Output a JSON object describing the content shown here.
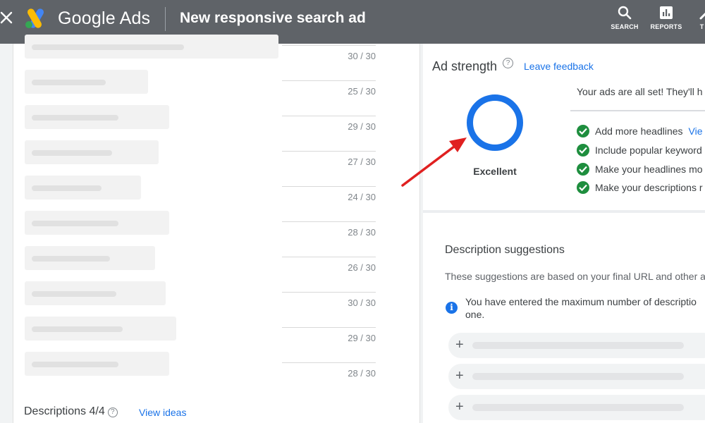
{
  "topbar": {
    "brand": "Google Ads",
    "page_title": "New responsive search ad",
    "tools": [
      {
        "label": "SEARCH",
        "icon": "search-icon"
      },
      {
        "label": "REPORTS",
        "icon": "reports-icon"
      },
      {
        "label": "T S",
        "icon": "tools-icon"
      }
    ]
  },
  "headlines": {
    "counters": [
      "30 / 30",
      "25 / 30",
      "29 / 30",
      "27 / 30",
      "24 / 30",
      "28 / 30",
      "26 / 30",
      "30 / 30",
      "29 / 30",
      "28 / 30"
    ]
  },
  "descriptions": {
    "heading": "Descriptions 4/4",
    "help": "?",
    "view_ideas": "View ideas"
  },
  "ad_strength": {
    "title": "Ad strength",
    "help": "?",
    "leave_feedback": "Leave feedback",
    "rating": "Excellent",
    "ring_color": "#1a73e8",
    "summary": "Your ads are all set! They'll h",
    "checklist": [
      {
        "text": "Add more headlines",
        "link": "Vie"
      },
      {
        "text": "Include popular keyword",
        "link": ""
      },
      {
        "text": "Make your headlines mo",
        "link": ""
      },
      {
        "text": "Make your descriptions r",
        "link": ""
      }
    ],
    "check_color": "#1e8e3e"
  },
  "description_suggestions": {
    "title": "Description suggestions",
    "subtitle": "These suggestions are based on your final URL and other a",
    "info_line1": "You have entered the maximum number of descriptio",
    "info_line2": "one.",
    "add_symbol": "+"
  },
  "annotation": {
    "arrow_color": "#e02020"
  }
}
